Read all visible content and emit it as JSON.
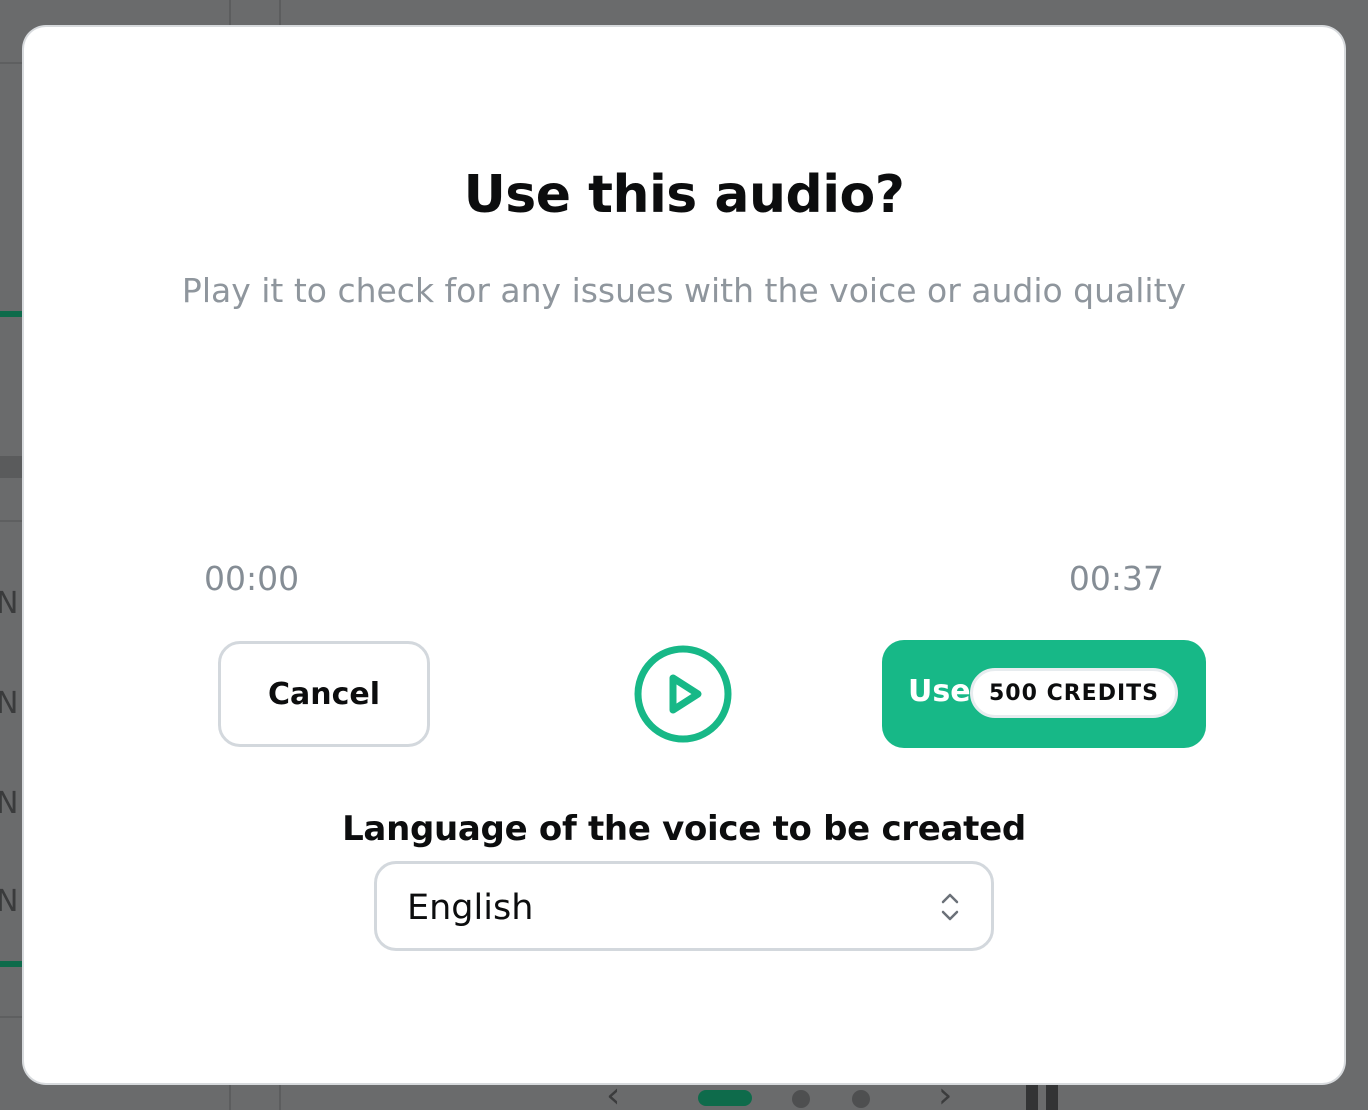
{
  "background": {
    "row_letters": [
      "N",
      "N",
      "N",
      "N"
    ]
  },
  "modal": {
    "title": "Use this audio?",
    "subtitle": "Play it to check for any issues with the voice or audio quality",
    "player": {
      "current_time": "00:00",
      "duration": "00:37",
      "play_icon": "play-circle-icon"
    },
    "cancel_label": "Cancel",
    "use_button": {
      "label": "Use",
      "credits_badge": "500 CREDITS"
    },
    "language": {
      "label": "Language of the voice to be created",
      "selected": "English",
      "icon": "chevron-up-down-icon"
    }
  },
  "colors": {
    "accent": "#17b887",
    "overlay": "#6a6b6c",
    "muted_text": "#8f969d",
    "border": "#d3d8dd"
  }
}
